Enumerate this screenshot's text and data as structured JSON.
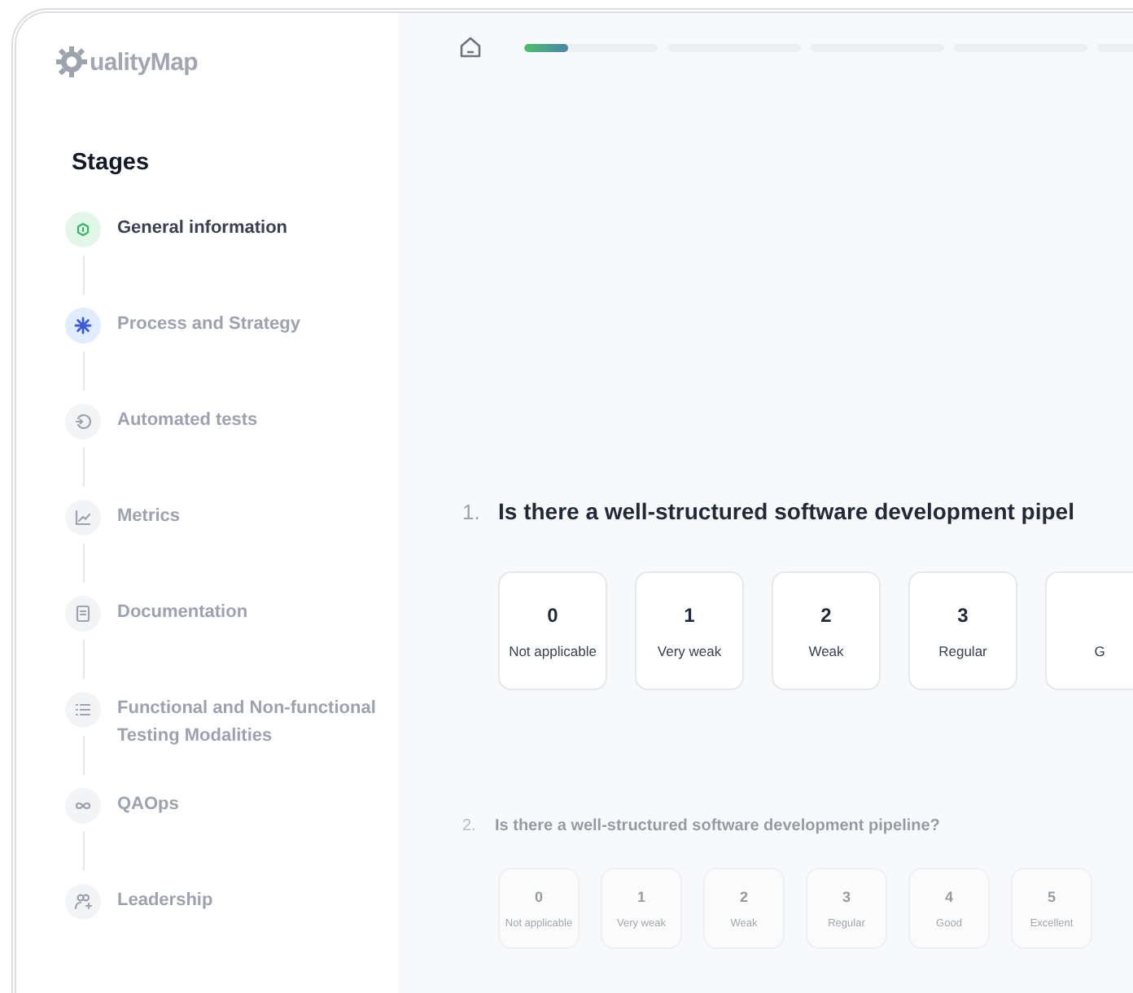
{
  "logo": {
    "text": "ualityMap"
  },
  "sidebar": {
    "title": "Stages",
    "stages": [
      {
        "label": "General information",
        "completed": true,
        "selected": false
      },
      {
        "label": "Process and Strategy",
        "completed": false,
        "selected": true
      },
      {
        "label": "Automated tests",
        "completed": false,
        "selected": false
      },
      {
        "label": "Metrics",
        "completed": false,
        "selected": false
      },
      {
        "label": "Documentation",
        "completed": false,
        "selected": false
      },
      {
        "label": "Functional and Non-functional Testing Modalities",
        "completed": false,
        "selected": false
      },
      {
        "label": "QAOps",
        "completed": false,
        "selected": false
      },
      {
        "label": "Leadership",
        "completed": false,
        "selected": false
      }
    ]
  },
  "progress": {
    "level": 0.33
  },
  "questions": [
    {
      "number": "1.",
      "text": "Is there a well-structured software development pipel",
      "active": true,
      "options": [
        {
          "value": "0",
          "label": "Not applicable"
        },
        {
          "value": "1",
          "label": "Very weak"
        },
        {
          "value": "2",
          "label": "Weak"
        },
        {
          "value": "3",
          "label": "Regular"
        },
        {
          "label": "G"
        }
      ]
    },
    {
      "number": "2.",
      "text": "Is there a well-structured software development pipeline?",
      "active": false,
      "options": [
        {
          "value": "0",
          "label": "Not applicable"
        },
        {
          "value": "1",
          "label": "Very weak"
        },
        {
          "value": "2",
          "label": "Weak"
        },
        {
          "value": "3",
          "label": "Regular"
        },
        {
          "value": "4",
          "label": "Good"
        },
        {
          "value": "5",
          "label": "Excellent"
        }
      ]
    }
  ]
}
